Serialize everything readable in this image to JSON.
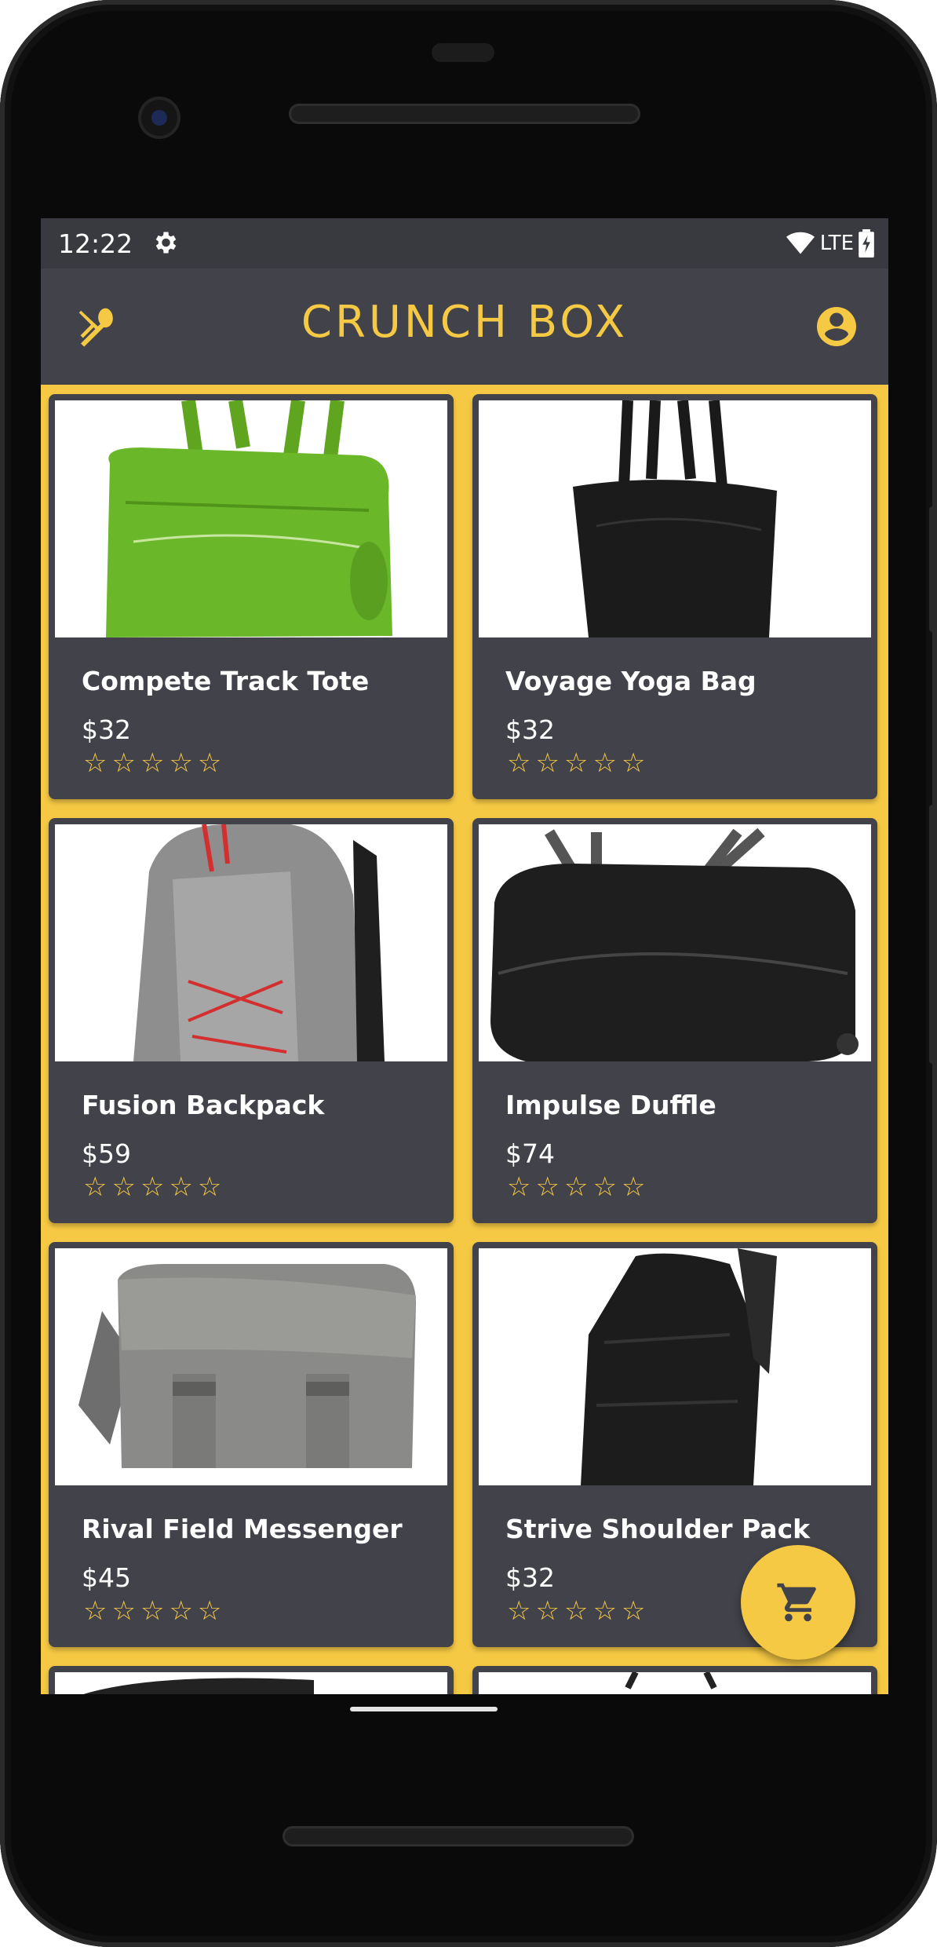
{
  "status_bar": {
    "time": "12:22",
    "network": "LTE"
  },
  "app_bar": {
    "title": "CRUNCH BOX",
    "left_icon": "utensils-icon",
    "right_icon": "account-circle-icon"
  },
  "colors": {
    "accent": "#f6c944",
    "card_bg": "#42424a",
    "appbar_bg": "#42424a",
    "statusbar_bg": "#393940"
  },
  "products": [
    {
      "name": "Compete Track Tote",
      "price": "$32",
      "rating_stars": 0,
      "image": "green duffle tote"
    },
    {
      "name": "Voyage Yoga Bag",
      "price": "$32",
      "rating_stars": 0,
      "image": "black tote bag"
    },
    {
      "name": "Fusion Backpack",
      "price": "$59",
      "rating_stars": 0,
      "image": "gray backpack with red laces"
    },
    {
      "name": "Impulse Duffle",
      "price": "$74",
      "rating_stars": 0,
      "image": "black rolling duffle"
    },
    {
      "name": "Rival Field Messenger",
      "price": "$45",
      "rating_stars": 0,
      "image": "gray messenger bag"
    },
    {
      "name": "Strive Shoulder Pack",
      "price": "$32",
      "rating_stars": 0,
      "image": "black shoulder pack"
    }
  ],
  "stars_glyph": "☆☆☆☆☆",
  "fab": {
    "icon": "shopping-cart-icon"
  }
}
